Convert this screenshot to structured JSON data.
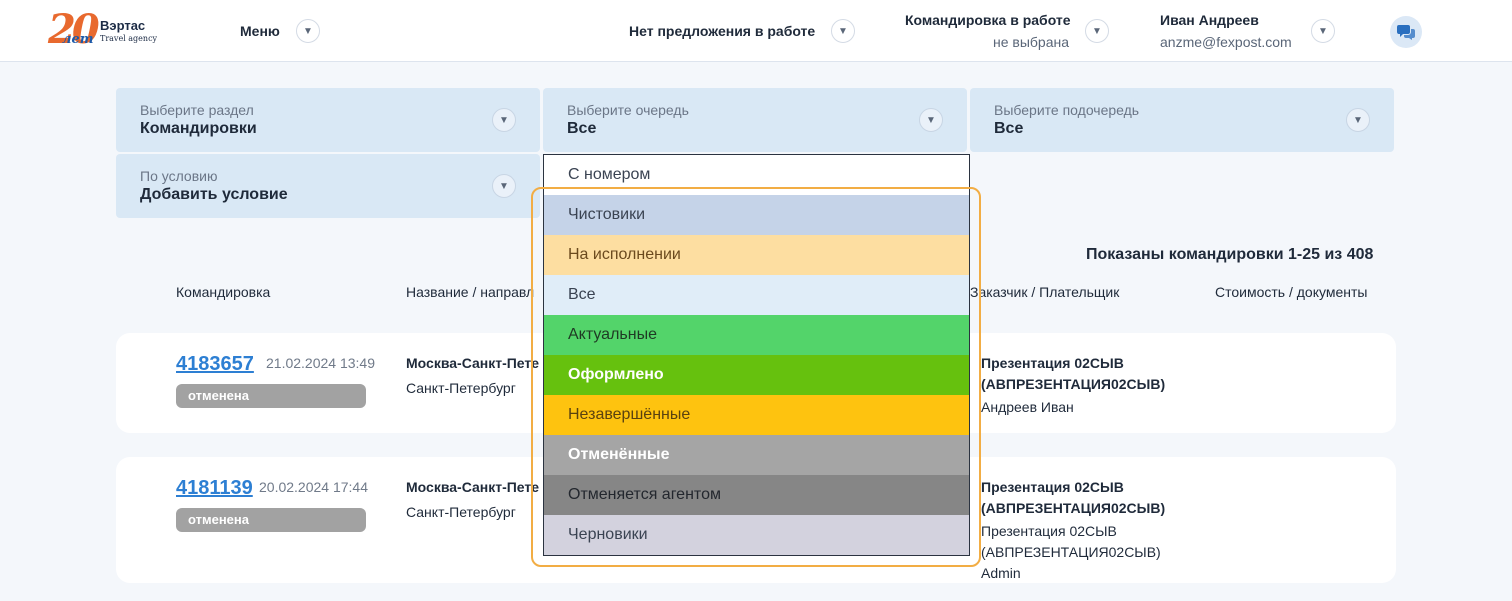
{
  "header": {
    "logo": {
      "number": "20",
      "suffix": "лет",
      "name": "Вэртас",
      "tagline": "Travel agency"
    },
    "menu_label": "Меню",
    "offer_label": "Нет предложения в работе",
    "trip_label": "Командировка в работе",
    "trip_value": "не выбрана",
    "user_name": "Иван Андреев",
    "user_email": "anzme@fexpost.com",
    "chat_icon": "chat-icon"
  },
  "filters": {
    "section": {
      "label": "Выберите раздел",
      "value": "Командировки"
    },
    "queue": {
      "label": "Выберите очередь",
      "value": "Все"
    },
    "subqueue": {
      "label": "Выберите подочередь",
      "value": "Все"
    },
    "condition": {
      "label": "По условию",
      "value": "Добавить условие"
    }
  },
  "queue_options": [
    {
      "label": "С номером",
      "bg": "#ffffff",
      "color": "#3a4352",
      "bold": false
    },
    {
      "label": "Чистовики",
      "bg": "#c5d3e8",
      "color": "#3a4352",
      "bold": false
    },
    {
      "label": "На исполнении",
      "bg": "#fddea1",
      "color": "#6b4a1e",
      "bold": false
    },
    {
      "label": "Все",
      "bg": "#e0edf8",
      "color": "#3a4352",
      "bold": false
    },
    {
      "label": "Актуальные",
      "bg": "#53d46a",
      "color": "#1f3a24",
      "bold": false
    },
    {
      "label": "Оформлено",
      "bg": "#66c10e",
      "color": "#ffffff",
      "bold": true
    },
    {
      "label": "Незавершённые",
      "bg": "#fec30f",
      "color": "#5a4210",
      "bold": false
    },
    {
      "label": "Отменённые",
      "bg": "#a5a5a5",
      "color": "#ffffff",
      "bold": true
    },
    {
      "label": "Отменяется агентом",
      "bg": "#868686",
      "color": "#23272e",
      "bold": false
    },
    {
      "label": "Черновики",
      "bg": "#d3d2de",
      "color": "#3a4352",
      "bold": false
    }
  ],
  "list": {
    "count_text": "Показаны командировки 1-25 из 408",
    "columns": {
      "trip": "Командировка",
      "name": "Название / направл",
      "customer": "Заказчик / Плательщик",
      "cost": "Стоимость / документы"
    },
    "rows": [
      {
        "id": "4183657",
        "date": "21.02.2024 13:49",
        "status": "отменена",
        "route": "Москва-Санкт-Пете",
        "city": "Санкт-Петербург",
        "customer_l1": "Презентация 02СЫВ",
        "customer_l2": "(АВПРЕЗЕНТАЦИЯ02СЫВ)",
        "payer_l1": "Андреев Иван"
      },
      {
        "id": "4181139",
        "date": "20.02.2024 17:44",
        "status": "отменена",
        "route": "Москва-Санкт-Пете",
        "city": "Санкт-Петербург",
        "customer_l1": "Презентация 02СЫВ",
        "customer_l2": "(АВПРЕЗЕНТАЦИЯ02СЫВ)",
        "payer_l1": "Презентация 02СЫВ",
        "payer_l2": "(АВПРЕЗЕНТАЦИЯ02СЫВ)",
        "payer_l3": "Admin"
      }
    ]
  }
}
